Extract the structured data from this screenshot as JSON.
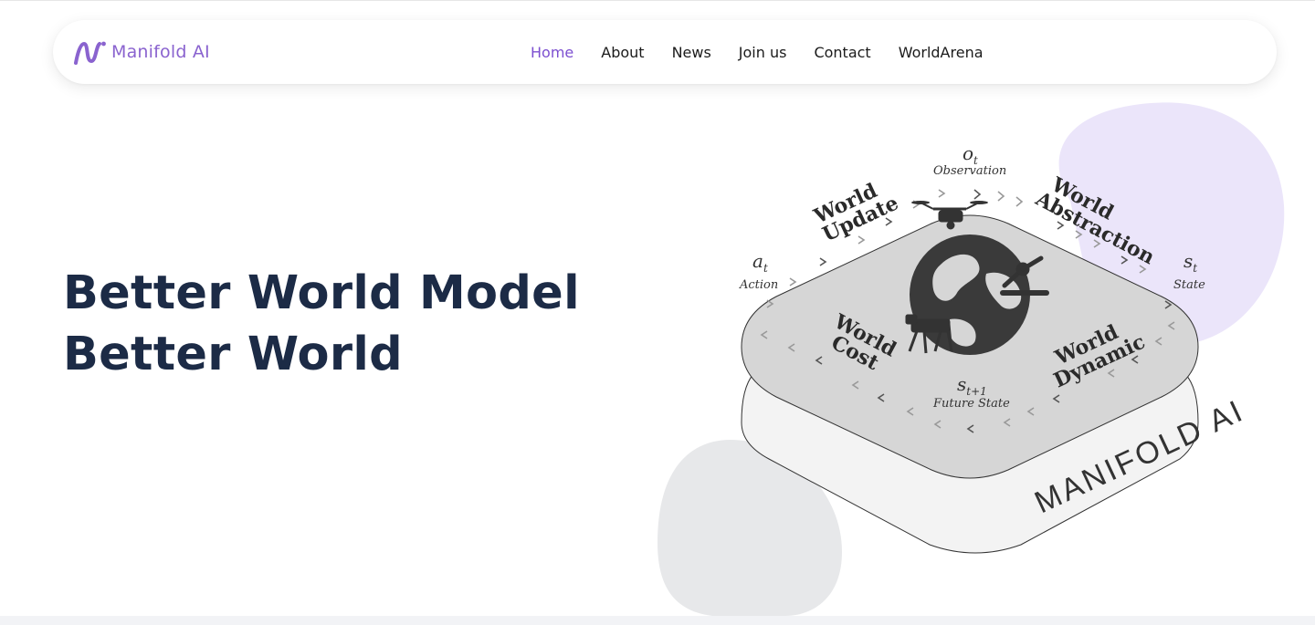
{
  "header": {
    "logo_text": "Manifold AI",
    "nav": [
      {
        "label": "Home",
        "active": true
      },
      {
        "label": "About",
        "active": false
      },
      {
        "label": "News",
        "active": false
      },
      {
        "label": "Join us",
        "active": false
      },
      {
        "label": "Contact",
        "active": false
      },
      {
        "label": "WorldArena",
        "active": false
      }
    ]
  },
  "hero": {
    "title_line1": "Better World Model",
    "title_line2": "Better World"
  },
  "diagram": {
    "observation_symbol": "o",
    "observation_sub": "t",
    "observation_label": "Observation",
    "action_symbol": "a",
    "action_sub": "t",
    "action_label": "Action",
    "state_symbol": "s",
    "state_sub": "t",
    "state_label": "State",
    "future_symbol": "s",
    "future_sub": "t+1",
    "future_label": "Future State",
    "world_update": [
      "World",
      "Update"
    ],
    "world_abstraction": [
      "World",
      "Abstraction"
    ],
    "world_cost": [
      "World",
      "Cost"
    ],
    "world_dynamic": [
      "World",
      "Dynamic"
    ],
    "base_label": "MANIFOLD AI"
  },
  "colors": {
    "brand_purple": "#8a63cf",
    "nav_active": "#7c4fd0",
    "title_navy": "#1c2b46",
    "lavender_blob": "#ebe5fa",
    "gray_blob": "#e7e8ea",
    "top_plate": "#d6d6d6",
    "bottom_plate": "#f3f3f3",
    "ink": "#333333"
  },
  "icons": [
    "manifold-logo-icon",
    "earth-globe-icon",
    "drone-icon",
    "robot-arm-icon",
    "robot-dog-icon",
    "chevron-arrow-icon"
  ]
}
